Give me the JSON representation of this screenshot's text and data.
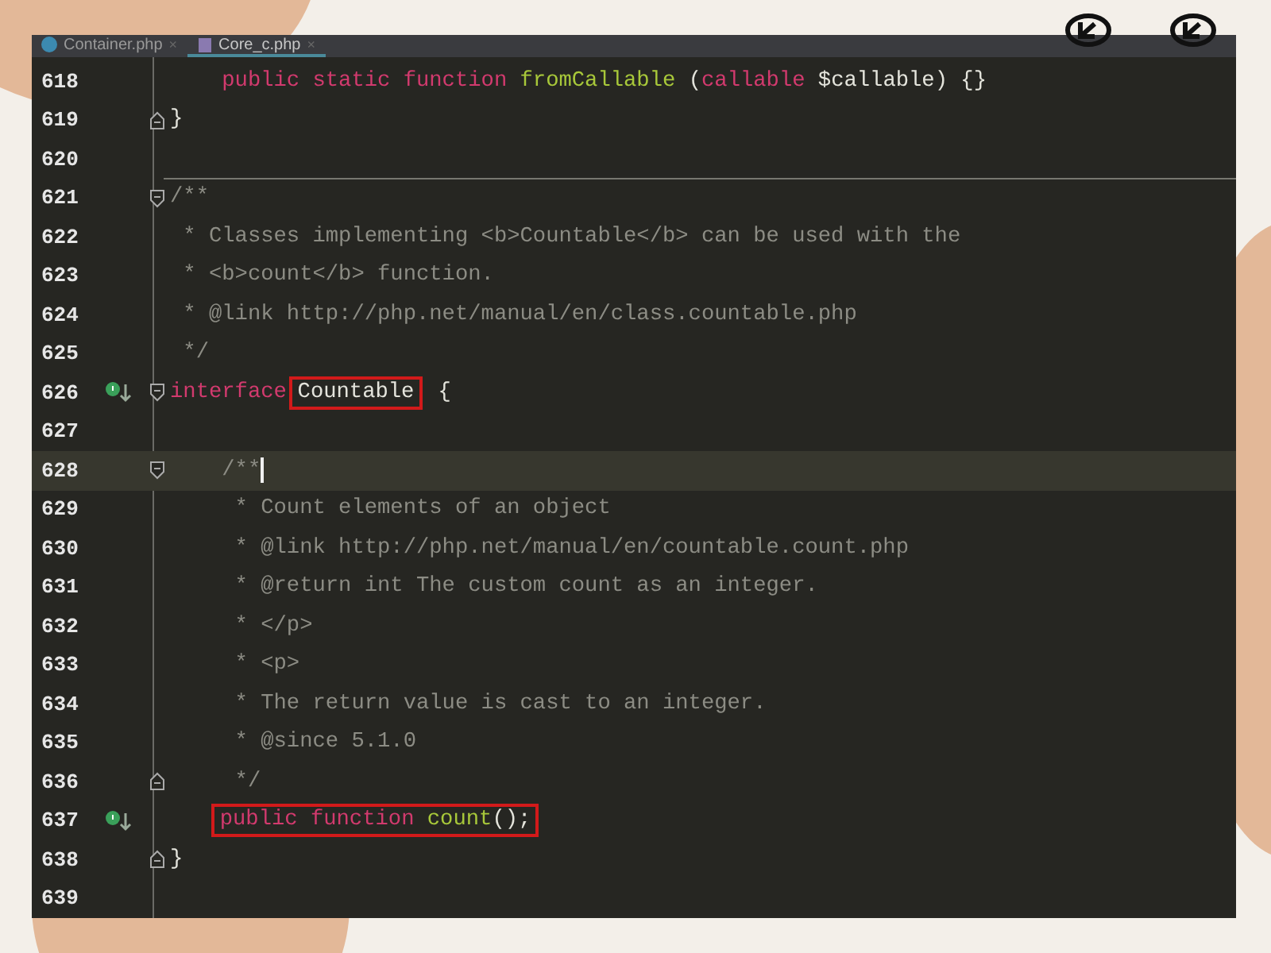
{
  "tabs": [
    {
      "label": "Container.php",
      "close": "×",
      "selected": false
    },
    {
      "label": "Core_c.php",
      "close": "×",
      "selected": true
    }
  ],
  "lines": [
    {
      "number": "618",
      "tokens": [
        {
          "kind": "keyword",
          "text": "    public static function "
        },
        {
          "kind": "function",
          "text": "fromCallable"
        },
        {
          "kind": "plain",
          "text": " ("
        },
        {
          "kind": "keyword",
          "text": "callable"
        },
        {
          "kind": "plain",
          "text": " $callable) {}"
        }
      ]
    },
    {
      "number": "619",
      "fold_end": true,
      "tokens": [
        {
          "kind": "plain",
          "text": "}"
        }
      ]
    },
    {
      "number": "620"
    },
    {
      "number": "621",
      "fold_start": true,
      "separator": true,
      "tokens": [
        {
          "kind": "comment",
          "text": "/**"
        }
      ]
    },
    {
      "number": "622",
      "tokens": [
        {
          "kind": "comment",
          "text": " * Classes implementing <b>Countable</b> can be used with the"
        }
      ]
    },
    {
      "number": "623",
      "tokens": [
        {
          "kind": "comment",
          "text": " * <b>count</b> function."
        }
      ]
    },
    {
      "number": "624",
      "tokens": [
        {
          "kind": "comment",
          "text": " * @link http://php.net/manual/en/class.countable.php"
        }
      ]
    },
    {
      "number": "625",
      "tokens": [
        {
          "kind": "comment",
          "text": " */"
        }
      ]
    },
    {
      "number": "626",
      "fold_start": true,
      "marker": true,
      "tokens": [
        {
          "kind": "keyword",
          "text": "interface"
        },
        {
          "kind": "plain",
          "text": "Countable",
          "boxed": true
        },
        {
          "kind": "plain",
          "text": " {"
        }
      ]
    },
    {
      "number": "627"
    },
    {
      "number": "628",
      "fold_start": true,
      "current": true,
      "tokens": [
        {
          "kind": "comment",
          "text": "    /**"
        }
      ]
    },
    {
      "number": "629",
      "tokens": [
        {
          "kind": "comment",
          "text": "     * Count elements of an object"
        }
      ]
    },
    {
      "number": "630",
      "tokens": [
        {
          "kind": "comment",
          "text": "     * @link http://php.net/manual/en/countable.count.php"
        }
      ]
    },
    {
      "number": "631",
      "tokens": [
        {
          "kind": "comment",
          "text": "     * @return int The custom count as an integer."
        }
      ]
    },
    {
      "number": "632",
      "tokens": [
        {
          "kind": "comment",
          "text": "     * </p>"
        }
      ]
    },
    {
      "number": "633",
      "tokens": [
        {
          "kind": "comment",
          "text": "     * <p>"
        }
      ]
    },
    {
      "number": "634",
      "tokens": [
        {
          "kind": "comment",
          "text": "     * The return value is cast to an integer."
        }
      ]
    },
    {
      "number": "635",
      "tokens": [
        {
          "kind": "comment",
          "text": "     * @since 5.1.0"
        }
      ]
    },
    {
      "number": "636",
      "fold_end": true,
      "tokens": [
        {
          "kind": "comment",
          "text": "     */"
        }
      ]
    },
    {
      "number": "637",
      "marker": true,
      "tokens": [
        {
          "kind": "keyword",
          "text": "    public function ",
          "boxed": true
        },
        {
          "kind": "function",
          "text": "count",
          "boxed": true
        },
        {
          "kind": "plain",
          "text": "();",
          "boxed": true
        }
      ]
    },
    {
      "number": "638",
      "fold_end": true,
      "tokens": [
        {
          "kind": "plain",
          "text": "}"
        }
      ]
    },
    {
      "number": "639"
    }
  ]
}
